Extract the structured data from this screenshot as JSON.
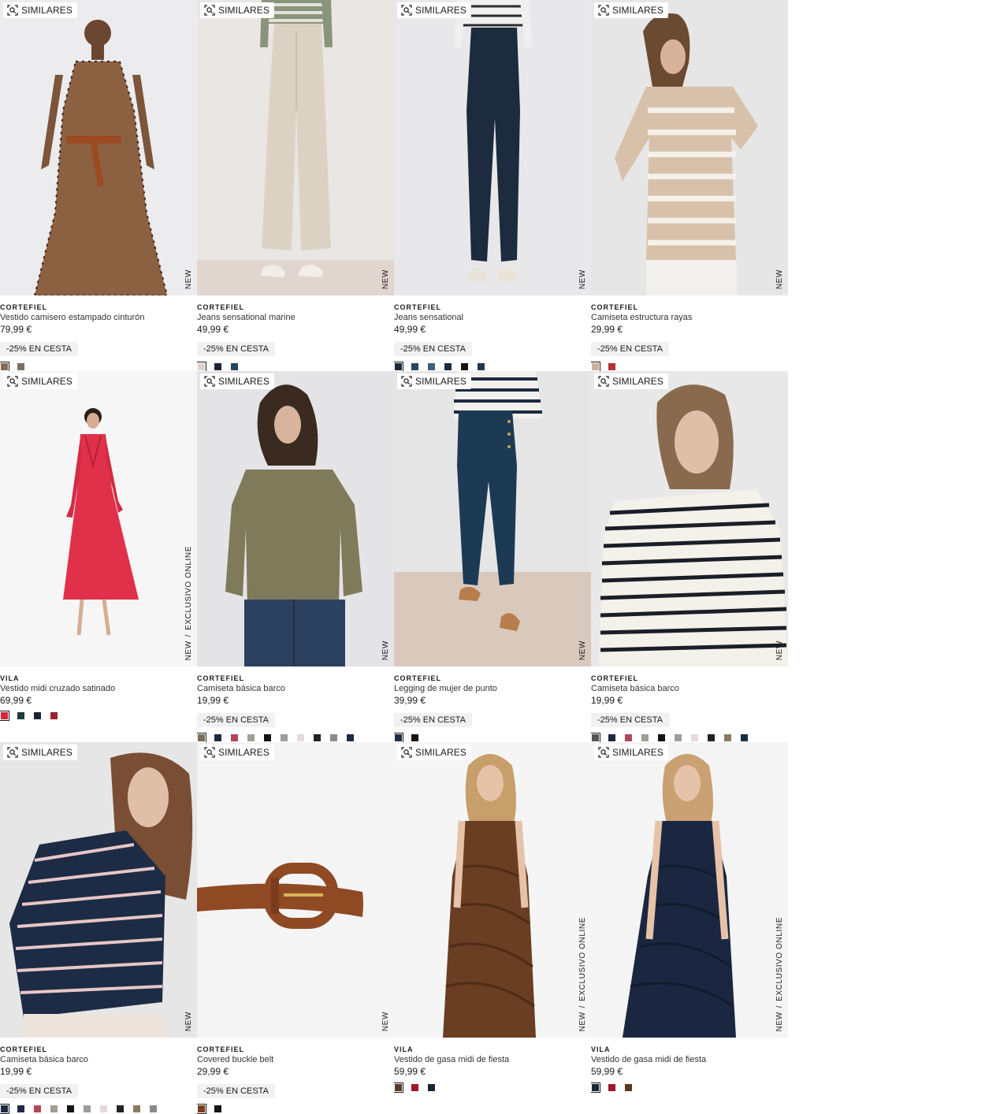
{
  "similar_label": "SIMILARES",
  "products": [
    {
      "brand": "CORTEFIEL",
      "name": "Vestido camisero estampado cinturón",
      "price": "79,99 €",
      "promo": "-25% EN CESTA",
      "tags": [
        "NEW"
      ],
      "colors": [
        {
          "hex": "#8a6a55",
          "selected": true
        },
        {
          "hex": "#7c7060"
        }
      ]
    },
    {
      "brand": "CORTEFIEL",
      "name": "Jeans sensational marine",
      "price": "49,99 €",
      "promo": "-25% EN CESTA",
      "tags": [
        "NEW"
      ],
      "colors": [
        {
          "hex": "#ddd3c8",
          "selected": true
        },
        {
          "hex": "#1d2535"
        },
        {
          "hex": "#214460"
        }
      ]
    },
    {
      "brand": "CORTEFIEL",
      "name": "Jeans sensational",
      "price": "49,99 €",
      "promo": "-25% EN CESTA",
      "tags": [
        "NEW"
      ],
      "colors": [
        {
          "hex": "#1c2a3a",
          "selected": true
        },
        {
          "hex": "#2a4660"
        },
        {
          "hex": "#3b5f80"
        },
        {
          "hex": "#1e2c3e"
        },
        {
          "hex": "#141414"
        },
        {
          "hex": "#203650"
        }
      ]
    },
    {
      "brand": "CORTEFIEL",
      "name": "Camiseta estructura rayas",
      "price": "29,99 €",
      "promo": "-25% EN CESTA",
      "tags": [
        "NEW"
      ],
      "colors": [
        {
          "hex": "#c9b39c",
          "selected": true
        },
        {
          "hex": "#b5302e"
        }
      ]
    },
    {
      "brand": "VILA",
      "name": "Vestido midi cruzado satinado",
      "price": "69,99 €",
      "promo": "",
      "tags": [
        "NEW",
        "EXCLUSIVO ONLINE"
      ],
      "colors": [
        {
          "hex": "#d7263d",
          "selected": true
        },
        {
          "hex": "#1f3b3a"
        },
        {
          "hex": "#1a2538"
        },
        {
          "hex": "#9a1f2f"
        }
      ]
    },
    {
      "brand": "CORTEFIEL",
      "name": "Camiseta básica barco",
      "price": "19,99 €",
      "promo": "-25% EN CESTA",
      "tags": [
        "NEW"
      ],
      "colors": [
        {
          "hex": "#7a6e55",
          "selected": true
        },
        {
          "hex": "#1d2a44"
        },
        {
          "hex": "#b2475a"
        },
        {
          "hex": "#a39e94"
        },
        {
          "hex": "#141414"
        },
        {
          "hex": "#9c9c9c"
        },
        {
          "hex": "#e6d8dc"
        },
        {
          "hex": "#222222"
        },
        {
          "hex": "#8a8a8a"
        },
        {
          "hex": "#1c2b44"
        }
      ]
    },
    {
      "brand": "CORTEFIEL",
      "name": "Legging de mujer de punto",
      "price": "39,99 €",
      "promo": "-25% EN CESTA",
      "tags": [
        "NEW"
      ],
      "colors": [
        {
          "hex": "#1d2f45",
          "selected": true
        },
        {
          "hex": "#141414"
        }
      ]
    },
    {
      "brand": "CORTEFIEL",
      "name": "Camiseta básica barco",
      "price": "19,99 €",
      "promo": "-25% EN CESTA",
      "tags": [
        "NEW"
      ],
      "colors": [
        {
          "hex": "#555555",
          "selected": true
        },
        {
          "hex": "#1d2a44"
        },
        {
          "hex": "#b2475a"
        },
        {
          "hex": "#a39e94"
        },
        {
          "hex": "#141414"
        },
        {
          "hex": "#9c9c9c"
        },
        {
          "hex": "#e6d8dc"
        },
        {
          "hex": "#222222"
        },
        {
          "hex": "#8a7a60"
        },
        {
          "hex": "#1c2b44"
        }
      ]
    },
    {
      "brand": "CORTEFIEL",
      "name": "Camiseta básica barco",
      "price": "19,99 €",
      "promo": "-25% EN CESTA",
      "tags": [
        "NEW"
      ],
      "colors": [
        {
          "hex": "#1c2b44",
          "selected": true
        },
        {
          "hex": "#1d2a44"
        },
        {
          "hex": "#b2475a"
        },
        {
          "hex": "#a39e94"
        },
        {
          "hex": "#141414"
        },
        {
          "hex": "#9c9c9c"
        },
        {
          "hex": "#e6d8dc"
        },
        {
          "hex": "#222222"
        },
        {
          "hex": "#8a7a60"
        },
        {
          "hex": "#8a8a8a"
        }
      ]
    },
    {
      "brand": "CORTEFIEL",
      "name": "Covered buckle belt",
      "price": "29,99 €",
      "promo": "-25% EN CESTA",
      "tags": [
        "NEW"
      ],
      "colors": [
        {
          "hex": "#7a3f1c",
          "selected": true
        },
        {
          "hex": "#141414"
        }
      ]
    },
    {
      "brand": "VILA",
      "name": "Vestido de gasa midi de fiesta",
      "price": "59,99 €",
      "promo": "",
      "tags": [
        "NEW",
        "EXCLUSIVO ONLINE"
      ],
      "colors": [
        {
          "hex": "#5a3a22",
          "selected": true
        },
        {
          "hex": "#a01828"
        },
        {
          "hex": "#1a2538"
        }
      ]
    },
    {
      "brand": "VILA",
      "name": "Vestido de gasa midi de fiesta",
      "price": "59,99 €",
      "promo": "",
      "tags": [
        "NEW",
        "EXCLUSIVO ONLINE"
      ],
      "colors": [
        {
          "hex": "#1a2538",
          "selected": true
        },
        {
          "hex": "#a01828"
        },
        {
          "hex": "#5a3a22"
        }
      ]
    }
  ]
}
